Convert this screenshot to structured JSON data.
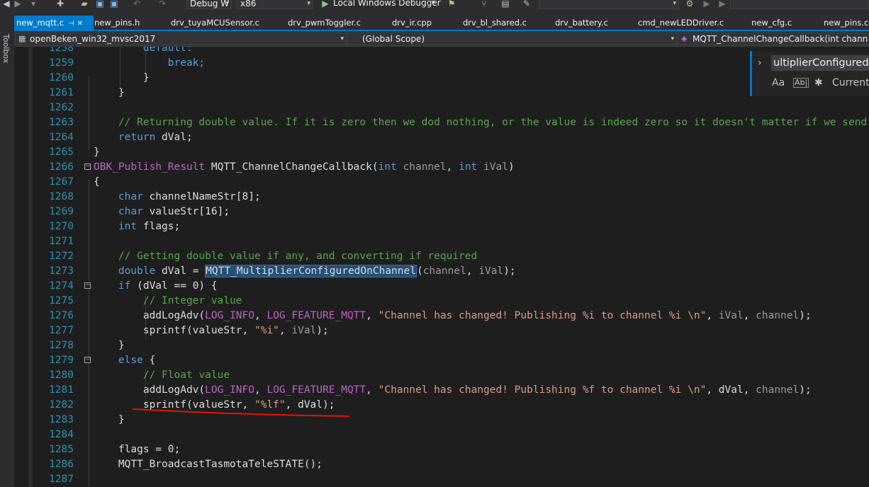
{
  "toolbar": {
    "config": "Debug W",
    "platform": "x86",
    "debugger": "Local Windows Debugger"
  },
  "toolbox_label": "Toolbox",
  "tabs": [
    {
      "label": "new_mqtt.c",
      "active": true
    },
    {
      "label": "new_pins.h"
    },
    {
      "label": "drv_tuyaMCUSensor.c"
    },
    {
      "label": "drv_pwmToggler.c"
    },
    {
      "label": "drv_ir.cpp"
    },
    {
      "label": "drv_bl_shared.c"
    },
    {
      "label": "drv_battery.c"
    },
    {
      "label": "cmd_newLEDDriver.c"
    },
    {
      "label": "new_cfg.c"
    },
    {
      "label": "new_pins.c"
    }
  ],
  "nav": {
    "project": "openBeken_win32_mvsc2017",
    "scope": "(Global Scope)",
    "member": "MQTT_ChannelChangeCallback(int channel, int"
  },
  "find": {
    "query": "ultiplierConfiguredOn",
    "option_case": "Aa",
    "option_word": "Ab|",
    "option_scope": "Current"
  },
  "line_numbers": [
    "1258",
    "1259",
    "1260",
    "1261",
    "1262",
    "1263",
    "1264",
    "1265",
    "1266",
    "1267",
    "1268",
    "1269",
    "1270",
    "1271",
    "1272",
    "1273",
    "1274",
    "1275",
    "1276",
    "1277",
    "1278",
    "1279",
    "1280",
    "1281",
    "1282",
    "1283",
    "1284",
    "1285",
    "1286",
    "1287"
  ],
  "code": {
    "l1258": "default:",
    "l1259": "break;",
    "l1260": "}",
    "l1261": "}",
    "l1263": "// Returning double value. If it is zero then we dod nothing, or the value is indeed zero so it doesn't matter if we send",
    "l1264_kw": "return",
    "l1264_rest": " dVal;",
    "l1265": "}",
    "l1266_mc": "OBK_Publish_Result",
    "l1266_fn": " MQTT_ChannelChangeCallback(",
    "l1266_int1": "int",
    "l1266_p1": " channel",
    "l1266_comma": ", ",
    "l1266_int2": "int",
    "l1266_p2": " iVal",
    "l1266_close": ")",
    "l1267": "{",
    "l1268_kw": "char",
    "l1268_rest": " channelNameStr[8];",
    "l1269_kw": "char",
    "l1269_rest": " valueStr[16];",
    "l1270_kw": "int",
    "l1270_rest": " flags;",
    "l1272": "// Getting double value if any, and converting if required",
    "l1273_kw": "double",
    "l1273_a": " dVal = ",
    "l1273_fn": "MQTT_MultiplierConfiguredOnChannel",
    "l1273_b": "(",
    "l1273_p1": "channel",
    "l1273_c": ", ",
    "l1273_p2": "iVal",
    "l1273_d": ");",
    "l1274_kw": "if",
    "l1274_rest": " (dVal == 0) {",
    "l1275": "// Integer value",
    "l1276_a": "addLogAdv(",
    "l1276_m1": "LOG_INFO",
    "l1276_b": ", ",
    "l1276_m2": "LOG_FEATURE_MQTT",
    "l1276_c": ", ",
    "l1276_s": "\"Channel has changed! Publishing %i to channel %i \\n\"",
    "l1276_d": ", ",
    "l1276_p1": "iVal",
    "l1276_e": ", ",
    "l1276_p2": "channel",
    "l1276_f": ");",
    "l1277_a": "sprintf(valueStr, ",
    "l1277_s": "\"%i\"",
    "l1277_b": ", ",
    "l1277_p": "iVal",
    "l1277_c": ");",
    "l1278": "}",
    "l1279_kw": "else",
    "l1279_rest": " {",
    "l1280": "// Float value",
    "l1281_a": "addLogAdv(",
    "l1281_m1": "LOG_INFO",
    "l1281_b": ", ",
    "l1281_m2": "LOG_FEATURE_MQTT",
    "l1281_c": ", ",
    "l1281_s": "\"Channel has changed! Publishing %f to channel %i \\n\"",
    "l1281_d": ", dVal, ",
    "l1281_p": "channel",
    "l1281_e": ");",
    "l1282_a": "sprintf(valueStr, ",
    "l1282_s": "\"%lf\"",
    "l1282_b": ", dVal);",
    "l1283": "}",
    "l1285": "flags = 0;",
    "l1286": "MQTT_BroadcastTasmotaTeleSTATE();"
  },
  "colors": {
    "tab_active": "#007acc",
    "keyword": "#569cd6",
    "comment": "#57a64a",
    "string": "#d69d85",
    "macro": "#bd63c5",
    "line_number": "#2b91af",
    "annotation_line": "#e51400"
  }
}
